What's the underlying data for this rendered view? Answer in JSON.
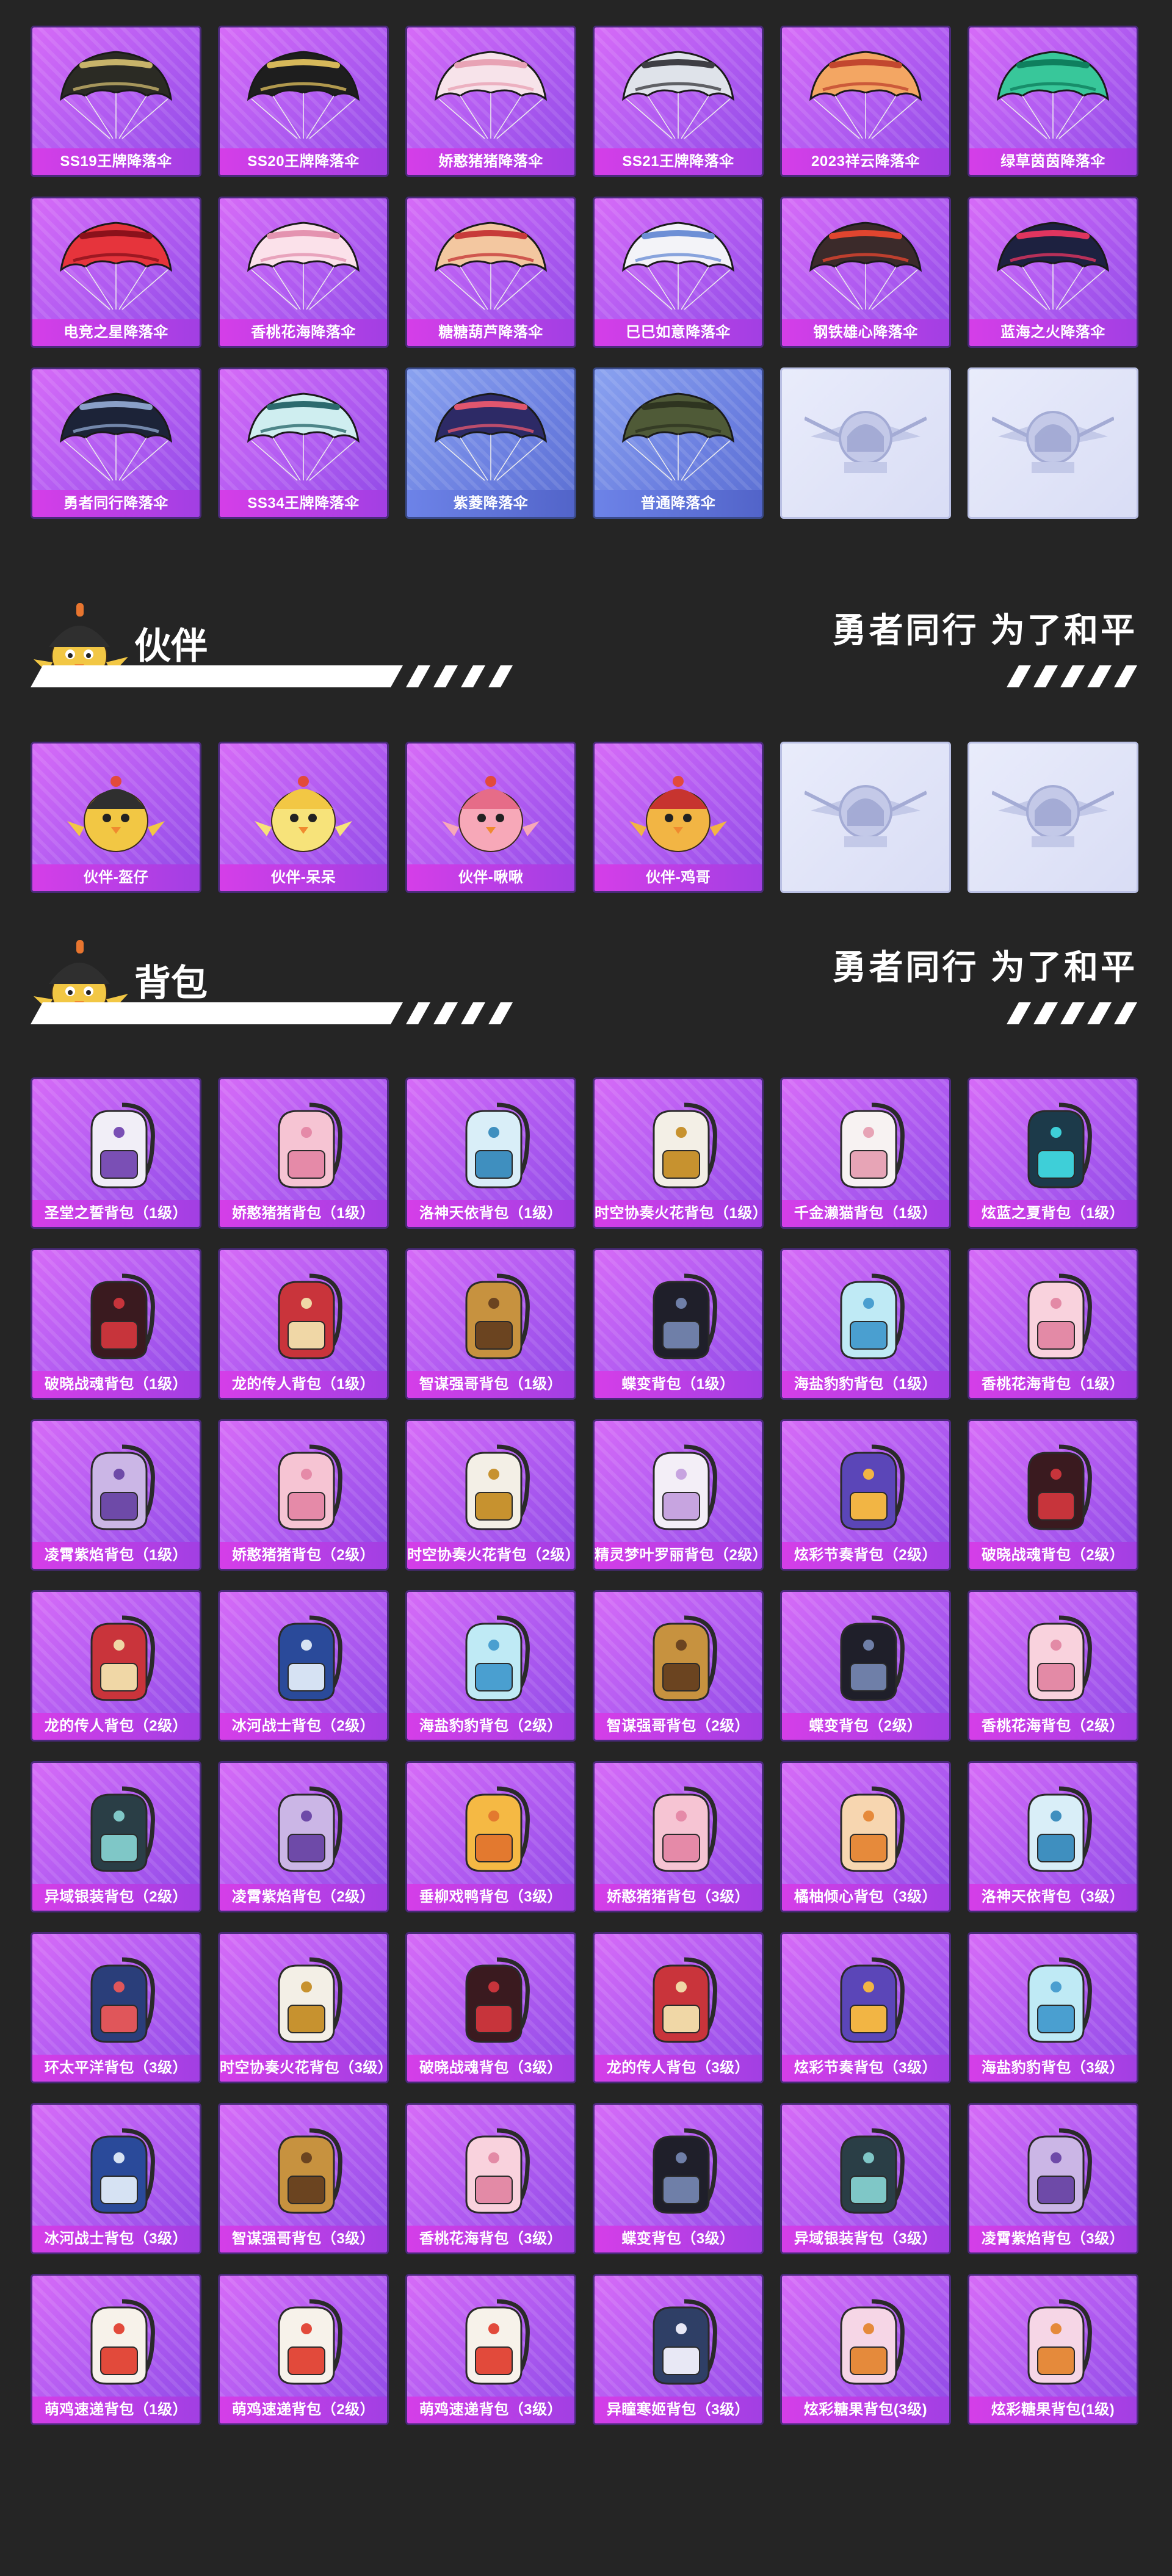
{
  "parachutes": {
    "items": [
      {
        "label": "SS19王牌降落伞",
        "style": "purple",
        "art": "parachute",
        "colors": [
          "#2b2b24",
          "#c7b36a"
        ]
      },
      {
        "label": "SS20王牌降落伞",
        "style": "purple",
        "art": "parachute",
        "colors": [
          "#1e1e1e",
          "#d6b85a"
        ]
      },
      {
        "label": "娇憨猪猪降落伞",
        "style": "purple",
        "art": "parachute",
        "colors": [
          "#f7e3ea",
          "#e8a3b5"
        ]
      },
      {
        "label": "SS21王牌降落伞",
        "style": "purple",
        "art": "parachute",
        "colors": [
          "#dfe3ea",
          "#3e3e44"
        ]
      },
      {
        "label": "2023祥云降落伞",
        "style": "purple",
        "art": "parachute",
        "colors": [
          "#f3a663",
          "#c2472f"
        ]
      },
      {
        "label": "绿草茵茵降落伞",
        "style": "purple",
        "art": "parachute",
        "colors": [
          "#38c79a",
          "#0f7f5e"
        ]
      },
      {
        "label": "电竞之星降落伞",
        "style": "purple",
        "art": "parachute",
        "colors": [
          "#e6343c",
          "#8b111b"
        ]
      },
      {
        "label": "香桃花海降落伞",
        "style": "purple",
        "art": "parachute",
        "colors": [
          "#fbe1ea",
          "#e493b0"
        ]
      },
      {
        "label": "糖糖葫芦降落伞",
        "style": "purple",
        "art": "parachute",
        "colors": [
          "#f3c7a0",
          "#c73b39"
        ]
      },
      {
        "label": "巳巳如意降落伞",
        "style": "purple",
        "art": "parachute",
        "colors": [
          "#f3f3f8",
          "#6d8fd6"
        ]
      },
      {
        "label": "钢铁雄心降落伞",
        "style": "purple",
        "art": "parachute",
        "colors": [
          "#3b2a2a",
          "#e0452f"
        ]
      },
      {
        "label": "蓝海之火降落伞",
        "style": "purple",
        "art": "parachute",
        "colors": [
          "#1d2140",
          "#e0355f"
        ]
      },
      {
        "label": "勇者同行降落伞",
        "style": "purple",
        "art": "parachute",
        "colors": [
          "#1c2338",
          "#8aa0c8"
        ]
      },
      {
        "label": "SS34王牌降落伞",
        "style": "purple",
        "art": "parachute",
        "colors": [
          "#cfeef0",
          "#2c6a6e"
        ]
      },
      {
        "label": "紫菱降落伞",
        "style": "blue",
        "art": "parachute",
        "colors": [
          "#2d2a66",
          "#e0566e"
        ]
      },
      {
        "label": "普通降落伞",
        "style": "blue",
        "art": "parachute",
        "colors": [
          "#4f5a37",
          "#2e3420"
        ]
      },
      {
        "label": "",
        "style": "empty",
        "art": "emblem",
        "colors": [
          "#bfc5e6",
          "#9aa2cf"
        ]
      },
      {
        "label": "",
        "style": "empty",
        "art": "emblem",
        "colors": [
          "#bfc5e6",
          "#9aa2cf"
        ]
      }
    ]
  },
  "companion_section": {
    "title": "伙伴",
    "slogan": "勇者同行 为了和平",
    "items": [
      {
        "label": "伙伴-盔仔",
        "style": "purple",
        "art": "chick",
        "colors": [
          "#f2c744",
          "#2f2f2f"
        ]
      },
      {
        "label": "伙伴-呆呆",
        "style": "purple",
        "art": "chick",
        "colors": [
          "#f7e37a",
          "#f2c744"
        ]
      },
      {
        "label": "伙伴-啾啾",
        "style": "purple",
        "art": "chick",
        "colors": [
          "#f7a8b8",
          "#e66c88"
        ]
      },
      {
        "label": "伙伴-鸡哥",
        "style": "purple",
        "art": "chick",
        "colors": [
          "#f2b544",
          "#c7342f"
        ]
      },
      {
        "label": "",
        "style": "empty",
        "art": "emblem",
        "colors": [
          "#bfc5e6",
          "#9aa2cf"
        ]
      },
      {
        "label": "",
        "style": "empty",
        "art": "emblem",
        "colors": [
          "#bfc5e6",
          "#9aa2cf"
        ]
      }
    ]
  },
  "backpack_section": {
    "title": "背包",
    "slogan": "勇者同行 为了和平",
    "items": [
      {
        "label": "圣堂之誓背包（1级）",
        "style": "purple",
        "art": "bag",
        "colors": [
          "#f1eef7",
          "#7a4fb5"
        ]
      },
      {
        "label": "娇憨猪猪背包（1级）",
        "style": "purple",
        "art": "bag",
        "colors": [
          "#f6c4d3",
          "#e58aa8"
        ]
      },
      {
        "label": "洛神天依背包（1级）",
        "style": "purple",
        "art": "bag",
        "colors": [
          "#d9eef8",
          "#3f8fbf"
        ]
      },
      {
        "label": "时空协奏火花背包（1级）",
        "style": "purple",
        "art": "bag",
        "colors": [
          "#f3efe6",
          "#c7922f"
        ]
      },
      {
        "label": "千金濑猫背包（1级）",
        "style": "purple",
        "art": "bag",
        "colors": [
          "#f7f2f2",
          "#e7a4b6"
        ]
      },
      {
        "label": "炫蓝之夏背包（1级）",
        "style": "purple",
        "art": "bag",
        "colors": [
          "#1c3a4a",
          "#3ecfd8"
        ]
      },
      {
        "label": "破晓战魂背包（1级）",
        "style": "purple",
        "art": "bag",
        "colors": [
          "#3a1a1f",
          "#c7343b"
        ]
      },
      {
        "label": "龙的传人背包（1级）",
        "style": "purple",
        "art": "bag",
        "colors": [
          "#c9343b",
          "#f0d7a6"
        ]
      },
      {
        "label": "智谋强哥背包（1级）",
        "style": "purple",
        "art": "bag",
        "colors": [
          "#c7923f",
          "#6b4420"
        ]
      },
      {
        "label": "蝶变背包（1级）",
        "style": "purple",
        "art": "bag",
        "colors": [
          "#1f1f2a",
          "#6f7fa8"
        ]
      },
      {
        "label": "海盐豹豹背包（1级）",
        "style": "purple",
        "art": "bag",
        "colors": [
          "#bfeaf5",
          "#4a9fd0"
        ]
      },
      {
        "label": "香桃花海背包（1级）",
        "style": "purple",
        "art": "bag",
        "colors": [
          "#f9d2dd",
          "#e38aa6"
        ]
      },
      {
        "label": "凌霄紫焰背包（1级）",
        "style": "purple",
        "art": "bag",
        "colors": [
          "#cbb6e6",
          "#6e4aa8"
        ]
      },
      {
        "label": "娇憨猪猪背包（2级）",
        "style": "purple",
        "art": "bag",
        "colors": [
          "#f6c4d3",
          "#e58aa8"
        ]
      },
      {
        "label": "时空协奏火花背包（2级）",
        "style": "purple",
        "art": "bag",
        "colors": [
          "#f3efe6",
          "#c7922f"
        ]
      },
      {
        "label": "精灵梦叶罗丽背包（2级）",
        "style": "purple",
        "art": "bag",
        "colors": [
          "#f3eef7",
          "#c7a4e0"
        ]
      },
      {
        "label": "炫彩节奏背包（2级）",
        "style": "purple",
        "art": "bag",
        "colors": [
          "#5b46b8",
          "#f2b544"
        ]
      },
      {
        "label": "破晓战魂背包（2级）",
        "style": "purple",
        "art": "bag",
        "colors": [
          "#3a1a1f",
          "#c7343b"
        ]
      },
      {
        "label": "龙的传人背包（2级）",
        "style": "purple",
        "art": "bag",
        "colors": [
          "#c9343b",
          "#f0d7a6"
        ]
      },
      {
        "label": "冰河战士背包（2级）",
        "style": "purple",
        "art": "bag",
        "colors": [
          "#2a4a9a",
          "#d6e2f3"
        ]
      },
      {
        "label": "海盐豹豹背包（2级）",
        "style": "purple",
        "art": "bag",
        "colors": [
          "#bfeaf5",
          "#4a9fd0"
        ]
      },
      {
        "label": "智谋强哥背包（2级）",
        "style": "purple",
        "art": "bag",
        "colors": [
          "#c7923f",
          "#6b4420"
        ]
      },
      {
        "label": "蝶变背包（2级）",
        "style": "purple",
        "art": "bag",
        "colors": [
          "#1f1f2a",
          "#6f7fa8"
        ]
      },
      {
        "label": "香桃花海背包（2级）",
        "style": "purple",
        "art": "bag",
        "colors": [
          "#f9d2dd",
          "#e38aa6"
        ]
      },
      {
        "label": "异域银装背包（2级）",
        "style": "purple",
        "art": "bag",
        "colors": [
          "#2a3e46",
          "#7fc7c7"
        ]
      },
      {
        "label": "凌霄紫焰背包（2级）",
        "style": "purple",
        "art": "bag",
        "colors": [
          "#cbb6e6",
          "#6e4aa8"
        ]
      },
      {
        "label": "垂柳戏鸭背包（3级）",
        "style": "purple",
        "art": "bag",
        "colors": [
          "#f5b944",
          "#e3792f"
        ]
      },
      {
        "label": "娇憨猪猪背包（3级）",
        "style": "purple",
        "art": "bag",
        "colors": [
          "#f6c4d3",
          "#e58aa8"
        ]
      },
      {
        "label": "橘柚倾心背包（3级）",
        "style": "purple",
        "art": "bag",
        "colors": [
          "#f7d6b0",
          "#e68a3b"
        ]
      },
      {
        "label": "洛神天依背包（3级）",
        "style": "purple",
        "art": "bag",
        "colors": [
          "#d9eef8",
          "#3f8fbf"
        ]
      },
      {
        "label": "环太平洋背包（3级）",
        "style": "purple",
        "art": "bag",
        "colors": [
          "#2a3e7a",
          "#e0565a"
        ]
      },
      {
        "label": "时空协奏火花背包（3级）",
        "style": "purple",
        "art": "bag",
        "colors": [
          "#f3efe6",
          "#c7922f"
        ]
      },
      {
        "label": "破晓战魂背包（3级）",
        "style": "purple",
        "art": "bag",
        "colors": [
          "#3a1a1f",
          "#c7343b"
        ]
      },
      {
        "label": "龙的传人背包（3级）",
        "style": "purple",
        "art": "bag",
        "colors": [
          "#c9343b",
          "#f0d7a6"
        ]
      },
      {
        "label": "炫彩节奏背包（3级）",
        "style": "purple",
        "art": "bag",
        "colors": [
          "#5b46b8",
          "#f2b544"
        ]
      },
      {
        "label": "海盐豹豹背包（3级）",
        "style": "purple",
        "art": "bag",
        "colors": [
          "#bfeaf5",
          "#4a9fd0"
        ]
      },
      {
        "label": "冰河战士背包（3级）",
        "style": "purple",
        "art": "bag",
        "colors": [
          "#2a4a9a",
          "#d6e2f3"
        ]
      },
      {
        "label": "智谋强哥背包（3级）",
        "style": "purple",
        "art": "bag",
        "colors": [
          "#c7923f",
          "#6b4420"
        ]
      },
      {
        "label": "香桃花海背包（3级）",
        "style": "purple",
        "art": "bag",
        "colors": [
          "#f9d2dd",
          "#e38aa6"
        ]
      },
      {
        "label": "蝶变背包（3级）",
        "style": "purple",
        "art": "bag",
        "colors": [
          "#1f1f2a",
          "#6f7fa8"
        ]
      },
      {
        "label": "异域银装背包（3级）",
        "style": "purple",
        "art": "bag",
        "colors": [
          "#2a3e46",
          "#7fc7c7"
        ]
      },
      {
        "label": "凌霄紫焰背包（3级）",
        "style": "purple",
        "art": "bag",
        "colors": [
          "#cbb6e6",
          "#6e4aa8"
        ]
      },
      {
        "label": "萌鸡速递背包（1级）",
        "style": "purple",
        "art": "bag",
        "colors": [
          "#f7f2ea",
          "#e24a3b"
        ]
      },
      {
        "label": "萌鸡速递背包（2级）",
        "style": "purple",
        "art": "bag",
        "colors": [
          "#f7f2ea",
          "#e24a3b"
        ]
      },
      {
        "label": "萌鸡速递背包（3级）",
        "style": "purple",
        "art": "bag",
        "colors": [
          "#f7f2ea",
          "#e24a3b"
        ]
      },
      {
        "label": "异瞳寒姬背包（3级）",
        "style": "purple",
        "art": "bag",
        "colors": [
          "#2f3f66",
          "#e8e8f5"
        ]
      },
      {
        "label": "炫彩糖果背包(3级)",
        "style": "purple",
        "art": "bag",
        "colors": [
          "#f6d6e6",
          "#e58a3b"
        ]
      },
      {
        "label": "炫彩糖果背包(1级)",
        "style": "purple",
        "art": "bag",
        "colors": [
          "#f6d6e6",
          "#e58a3b"
        ]
      }
    ]
  }
}
